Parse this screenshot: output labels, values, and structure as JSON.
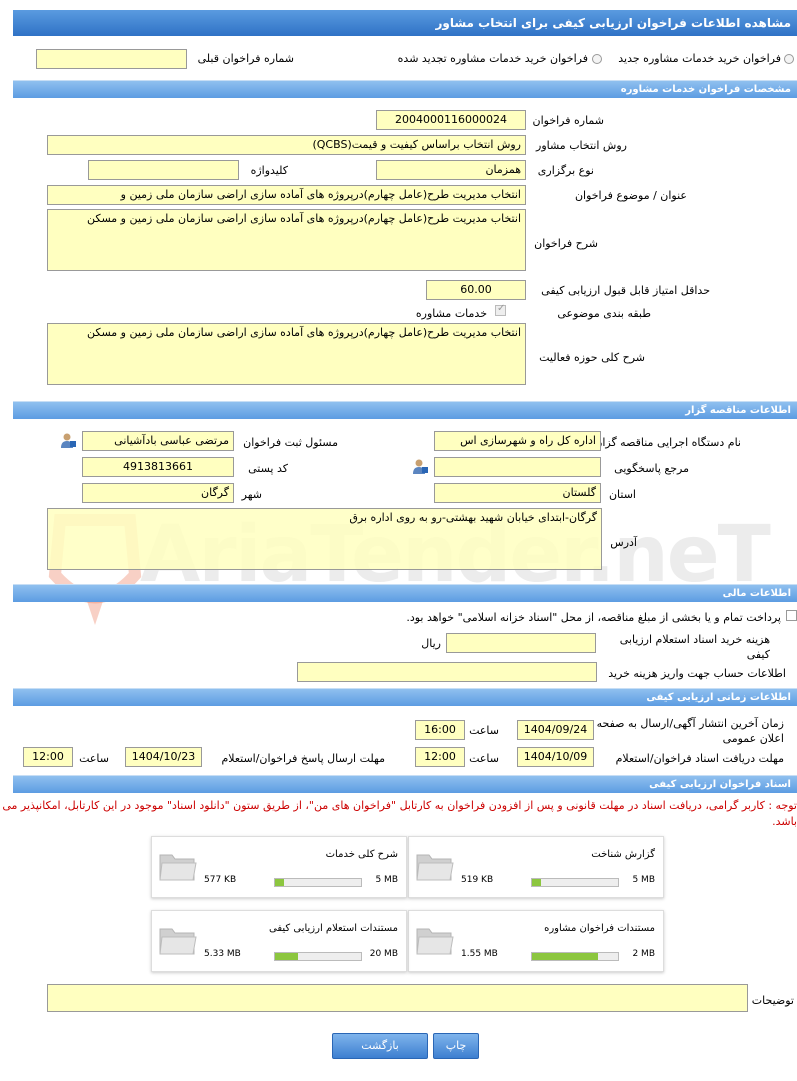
{
  "title": "مشاهده اطلاعات فراخوان ارزیابی کیفی برای انتخاب مشاور",
  "top": {
    "radio_new": "فراخوان خرید خدمات مشاوره جدید",
    "radio_renewed": "فراخوان خرید خدمات مشاوره تجدید شده",
    "prev_label": "شماره فراخوان قبلی",
    "prev_value": ""
  },
  "specs": {
    "header": "مشخصات فراخوان خدمات مشاوره",
    "number_label": "شماره فراخوان",
    "number_value": "2004000116000024",
    "method_label": "روش انتخاب مشاور",
    "method_value": "روش انتخاب براساس کیفیت و قیمت(QCBS)",
    "type_label": "نوع برگزاری",
    "type_value": "همزمان",
    "keyword_label": "کلیدواژه",
    "keyword_value": "",
    "subject_label": "عنوان / موضوع فراخوان",
    "subject_value": "انتخاب مدیریت طرح(عامل چهارم)درپروژه های آماده سازی اراضی سازمان ملی زمین و",
    "desc_label": "شرح فراخوان",
    "desc_value": "انتخاب مدیریت طرح(عامل چهارم)درپروژه های آماده سازی اراضی سازمان ملی زمین و مسکن",
    "minscore_label": "حداقل امتیاز قابل قبول ارزیابی کیفی",
    "minscore_value": "60.00",
    "category_label": "طبقه بندی موضوعی",
    "category_value": "خدمات مشاوره",
    "scope_label": "شرح کلی حوزه فعالیت",
    "scope_value": "انتخاب مدیریت طرح(عامل چهارم)درپروژه های آماده سازی اراضی سازمان ملی زمین و مسکن"
  },
  "tenderer": {
    "header": "اطلاعات مناقصه گزار",
    "org_label": "نام دستگاه اجرایی مناقصه گزار",
    "org_value": "اداره کل راه و شهرسازی اس",
    "registrar_label": "مسئول ثبت فراخوان",
    "registrar_value": "مرتضی عباسی بادآشیانی",
    "ref_label": "مرجع پاسخگویی",
    "ref_value": "",
    "postal_label": "کد پستی",
    "postal_value": "4913813661",
    "province_label": "استان",
    "province_value": "گلستان",
    "city_label": "شهر",
    "city_value": "گرگان",
    "address_label": "آدرس",
    "address_value": "گرگان-ابتدای خیابان شهید بهشتی-رو به روی اداره برق"
  },
  "finance": {
    "header": "اطلاعات مالی",
    "treasury_text": "پرداخت تمام و یا بخشی از مبلغ مناقصه، از محل \"اسناد خزانه اسلامی\" خواهد بود.",
    "fee_label": "هزینه خرید اسناد استعلام ارزیابی کیفی",
    "fee_value": "",
    "fee_unit": "ریال",
    "account_label": "اطلاعات حساب جهت واریز هزینه خرید",
    "account_value": ""
  },
  "timing": {
    "header": "اطلاعات زمانی ارزیابی کیفی",
    "publish_label": "زمان آخرین انتشار آگهی/ارسال به صفحه اعلان عمومی",
    "publish_date": "1404/09/24",
    "publish_time": "16:00",
    "receive_label": "مهلت دریافت اسناد فراخوان/استعلام",
    "receive_date": "1404/10/09",
    "receive_time": "12:00",
    "reply_label": "مهلت ارسال پاسخ فراخوان/استعلام",
    "reply_date": "1404/10/23",
    "reply_time": "12:00",
    "time_label": "ساعت"
  },
  "docs": {
    "header": "اسناد فراخوان ارزیابی کیفی",
    "note": "توجه : کاربر گرامی، دریافت اسناد در مهلت قانونی و پس از افزودن فراخوان به کارتابل \"فراخوان های من\"، از طریق ستون \"دانلود اسناد\" موجود در این کارتابل، امکانپذیر می باشد.",
    "cards": [
      {
        "title": "گزارش شناخت",
        "used": "519 KB",
        "max": "5 MB",
        "fraction": 0.1
      },
      {
        "title": "شرح کلی خدمات",
        "used": "577 KB",
        "max": "5 MB",
        "fraction": 0.11
      },
      {
        "title": "مستندات فراخوان مشاوره",
        "used": "1.55 MB",
        "max": "2 MB",
        "fraction": 0.77
      },
      {
        "title": "مستندات استعلام ارزیابی کیفی",
        "used": "5.33 MB",
        "max": "20 MB",
        "fraction": 0.27
      }
    ],
    "notes_label": "توضیحات",
    "notes_value": ""
  },
  "buttons": {
    "print": "چاپ",
    "back": "بازگشت"
  },
  "watermark": "AriaTender.neT",
  "colors": {
    "accent": "#2f72c6",
    "field": "#ffffc0",
    "bar": "#8cc63f",
    "note": "#cc0000"
  }
}
